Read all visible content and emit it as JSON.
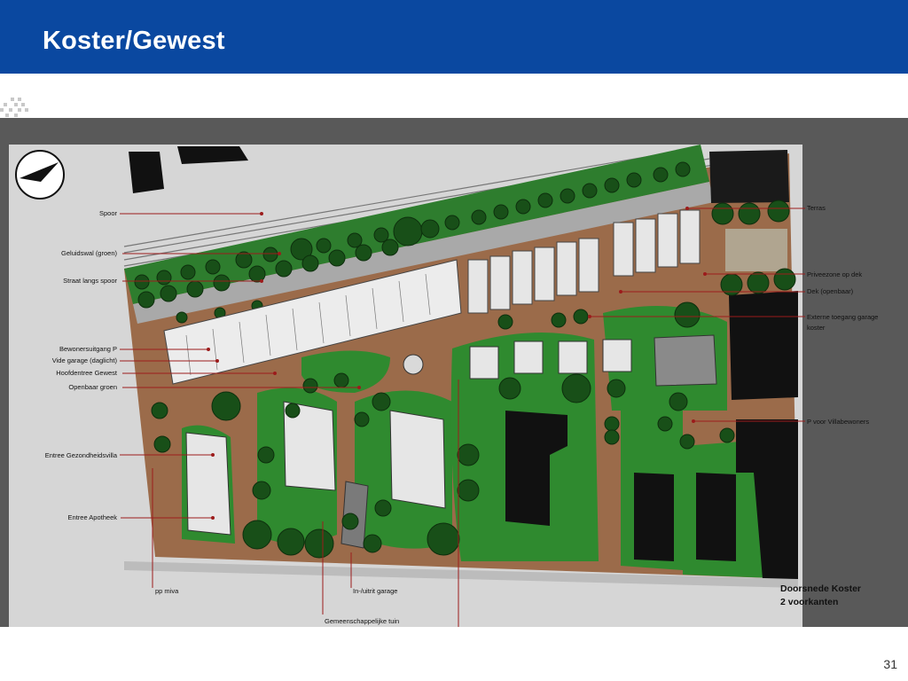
{
  "slide": {
    "title": "Koster/Gewest",
    "page_number": "31"
  },
  "colors": {
    "header": "#0a48a0",
    "dim_overlay": "#595959",
    "plan_paper": "#d6d6d6",
    "ground": "#9b6b4a",
    "lawn": "#2f8a2f",
    "tree": "#1a5a1a",
    "leader_line": "#9c1c1c"
  },
  "plan": {
    "labels_left": {
      "spoor": "Spoor",
      "geluidswal": "Geluidswal (groen)",
      "straat": "Straat langs spoor",
      "bewonersuitgang": "Bewonersuitgang P",
      "vide": "Vide garage (daglicht)",
      "hoofdentree": "Hoofdentree Gewest",
      "openbaar_groen": "Openbaar groen",
      "entree_villa": "Entree Gezondheidsvilla",
      "entree_apotheek": "Entree Apotheek"
    },
    "labels_right": {
      "terras": "Terras",
      "priveezone": "Priveezone op dek",
      "dek": "Dek (openbaar)",
      "externe_1": "Externe toegang garage",
      "externe_2": "koster",
      "p_villa": "P voor Villabewoners"
    },
    "labels_bottom": {
      "pp_miva": "pp miva",
      "in_uitrit": "In-/uitrit garage",
      "gemeenschappelijk": "Gemeenschappelijke tuin"
    },
    "caption": {
      "line1": "Doorsnede Koster",
      "line2": "2 voorkanten"
    }
  }
}
